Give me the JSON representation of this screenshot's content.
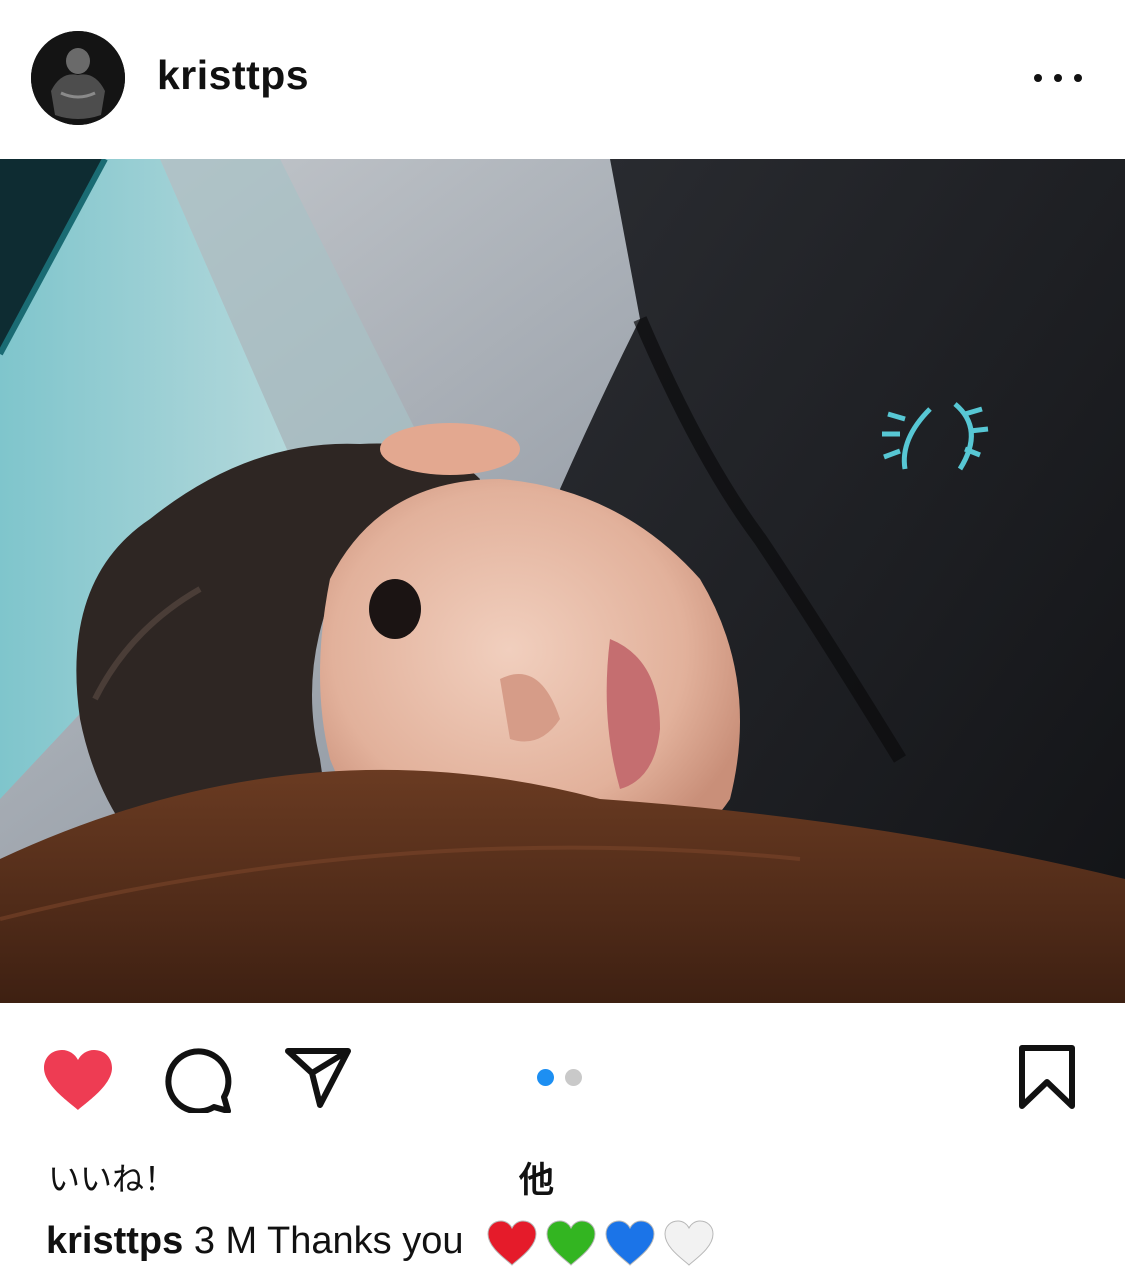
{
  "header": {
    "username": "kristtps",
    "avatar_icon": "profile-avatar",
    "more_icon": "more-options-icon"
  },
  "post": {
    "carousel": {
      "total": 2,
      "current": 1,
      "active_color": "#1d8ff2",
      "inactive_color": "#c9c9c9"
    }
  },
  "actions": {
    "like_icon": "heart-filled-icon",
    "like_color": "#ee3c53",
    "comment_icon": "comment-icon",
    "share_icon": "send-icon",
    "save_icon": "bookmark-icon"
  },
  "likes": {
    "label": "いいね！",
    "others": "他"
  },
  "caption": {
    "username": "kristtps",
    "text": "3 M Thanks you",
    "hearts": [
      {
        "icon": "red-heart-emoji",
        "color": "#e51b2a"
      },
      {
        "icon": "green-heart-emoji",
        "color": "#33b521"
      },
      {
        "icon": "blue-heart-emoji",
        "color": "#1b74e8"
      },
      {
        "icon": "white-heart-emoji",
        "color": "#f2f2f2"
      }
    ]
  }
}
